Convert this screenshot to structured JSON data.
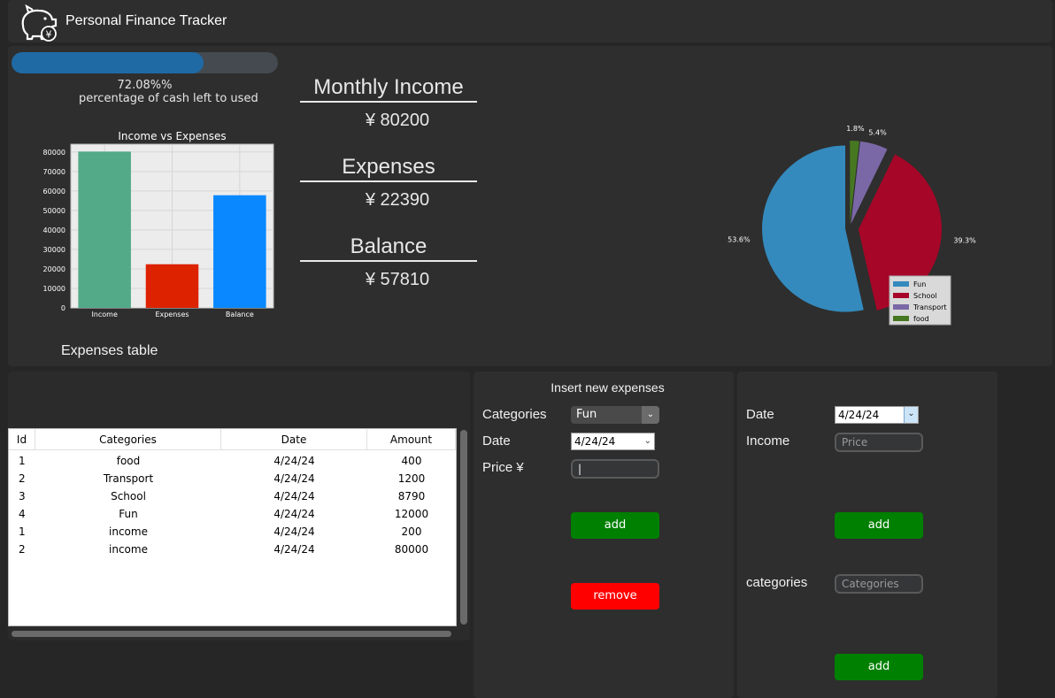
{
  "app": {
    "title": "Personal Finance Tracker",
    "logo_icon": "piggy-bank-yen-icon"
  },
  "progress": {
    "value": 0.7208,
    "percent_text": "72.08%%",
    "description": "percentage of cash left to used"
  },
  "stats": {
    "income_title": "Monthly Income",
    "income_value": "¥ 80200",
    "expenses_title": "Expenses",
    "expenses_value": "¥ 22390",
    "balance_title": "Balance",
    "balance_value": "¥ 57810"
  },
  "bar_chart": {
    "chart_data": {
      "type": "bar",
      "title": "Income vs Expenses",
      "categories": [
        "Income",
        "Expenses",
        "Balance"
      ],
      "values": [
        80200,
        22390,
        57810
      ],
      "colors": [
        "#52aa88",
        "#dd2200",
        "#0a88ff"
      ],
      "ylim": [
        0,
        84000
      ],
      "yticks": [
        0,
        10000,
        20000,
        30000,
        40000,
        50000,
        60000,
        70000,
        80000
      ],
      "grid": true
    }
  },
  "pie_chart": {
    "chart_data": {
      "type": "pie",
      "categories": [
        "Fun",
        "School",
        "Transport",
        "food"
      ],
      "values": [
        53.6,
        39.3,
        5.4,
        1.8
      ],
      "labels": [
        "53.6%",
        "39.3%",
        "5.4%",
        "1.8%"
      ],
      "colors": [
        "#348abd",
        "#a60628",
        "#7a68a6",
        "#467821"
      ],
      "legend": "bottom-right"
    }
  },
  "expenses_table": {
    "title": "Expenses table",
    "columns": [
      "Id",
      "Categories",
      "Date",
      "Amount"
    ],
    "rows": [
      [
        "1",
        "food",
        "4/24/24",
        "400"
      ],
      [
        "2",
        "Transport",
        "4/24/24",
        "1200"
      ],
      [
        "3",
        "School",
        "4/24/24",
        "8790"
      ],
      [
        "4",
        "Fun",
        "4/24/24",
        "12000"
      ],
      [
        "1",
        "income",
        "4/24/24",
        "200"
      ],
      [
        "2",
        "income",
        "4/24/24",
        "80000"
      ]
    ]
  },
  "insert_form": {
    "title": "Insert new expenses",
    "categories_label": "Categories",
    "category_value": "Fun",
    "date_label": "Date",
    "date_value": "4/24/24",
    "price_label": "Price ¥",
    "add_label": "add",
    "remove_label": "remove"
  },
  "income_form": {
    "date_label": "Date",
    "date_value": "4/24/24",
    "income_label": "Income",
    "price_placeholder": "Price",
    "add_label": "add",
    "categories_label": "categories",
    "categories_placeholder": "Categories",
    "add2_label": "add"
  }
}
